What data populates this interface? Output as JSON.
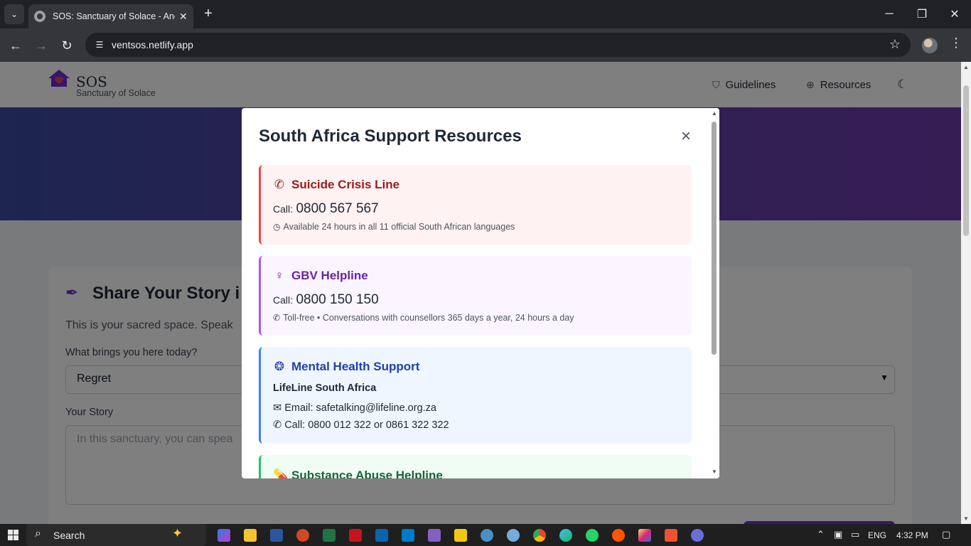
{
  "browser": {
    "tab_title": "SOS: Sanctuary of Solace - Anonymous",
    "tab_close": "✕",
    "new_tab": "+",
    "url": "ventsos.netlify.app",
    "window_controls": {
      "minimize": "─",
      "restore": "❐",
      "close": "✕"
    },
    "icons": [
      "tab-search-icon",
      "back-icon",
      "forward-icon",
      "reload-icon",
      "site-info-icon",
      "bookmark-star-icon",
      "profile-avatar",
      "browser-menu-icon"
    ]
  },
  "site": {
    "logo_title": "SOS",
    "logo_subtitle": "Sanctuary of Solace",
    "nav": [
      {
        "label": "Guidelines",
        "icon": "shield-icon"
      },
      {
        "label": "Resources",
        "icon": "lifebuoy-icon"
      }
    ],
    "theme_toggle_icon": "moon-icon",
    "brand_color": "#6d28d9"
  },
  "story_form": {
    "title": "Share Your Story i",
    "intro": "This is your sacred space. Speak",
    "topic_label": "What brings you here today?",
    "topic_selected": "Regret",
    "story_label": "Your Story",
    "story_placeholder": "In this sanctuary, you can spea"
  },
  "modal": {
    "title": "South Africa Support Resources",
    "close_symbol": "×",
    "resources": [
      {
        "name": "Suicide Crisis Line",
        "icon": "phone-icon",
        "color": "#991b1b",
        "border": "#ef4444",
        "bg": "#fef2f2",
        "call_label": "Call:",
        "number": "0800 567 567",
        "note_icon": "clock-icon",
        "note": "Available 24 hours in all 11 official South African languages"
      },
      {
        "name": "GBV Helpline",
        "icon": "female-icon",
        "color": "#6b21a8",
        "border": "#a855f7",
        "bg": "#faf5ff",
        "call_label": "Call:",
        "number": "0800 150 150",
        "note_icon": "phone-icon",
        "note": "Toll-free • Conversations with counsellors 365 days a year, 24 hours a day"
      },
      {
        "name": "Mental Health Support",
        "icon": "brain-icon",
        "color": "#1e40af",
        "border": "#3b82f6",
        "bg": "#eff6ff",
        "org": "LifeLine South Africa",
        "email": "Email: safetalking@lifeline.org.za",
        "phone": "Call: 0800 012 322 or 0861 322 322"
      },
      {
        "name": "Substance Abuse Helpline",
        "icon": "pills-icon",
        "color": "#166534",
        "border": "#22c55e",
        "bg": "#f0fdf4"
      }
    ]
  },
  "taskbar": {
    "search_label": "Search",
    "language": "ENG",
    "time": "4:32 PM",
    "apps": [
      "copilot",
      "file-explorer",
      "word",
      "powerpoint",
      "excel",
      "acrobat",
      "outlook",
      "vscode",
      "visual-studio",
      "power-bi",
      "feedback",
      "r-studio",
      "chrome",
      "edge",
      "whatsapp",
      "soundcloud",
      "instagram",
      "git",
      "settings"
    ]
  }
}
